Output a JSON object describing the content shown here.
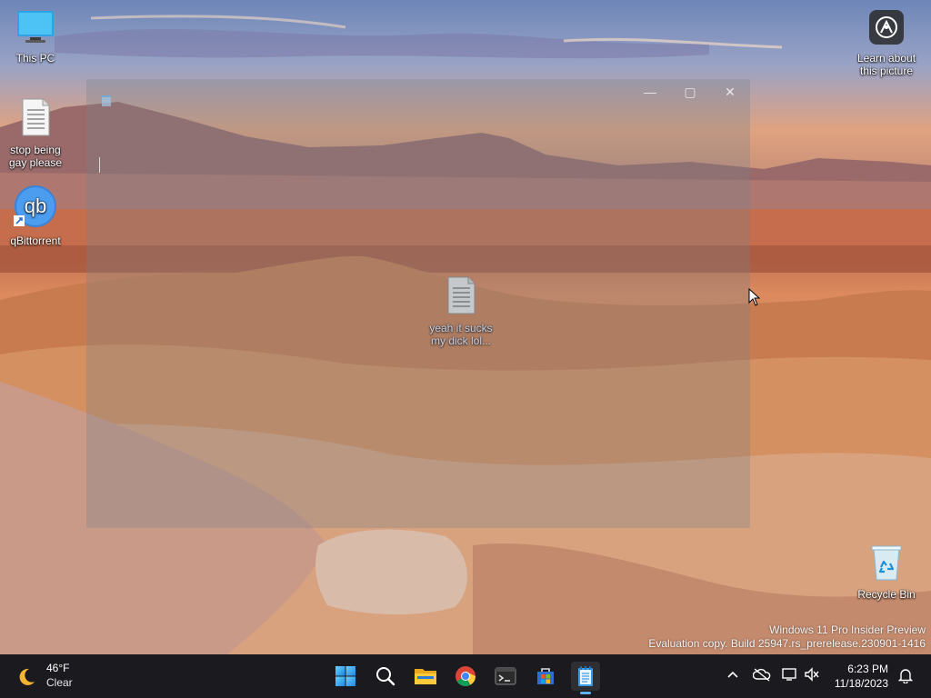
{
  "desktop": {
    "icons": [
      {
        "label": "This PC",
        "icon": "monitor-icon"
      },
      {
        "label": "stop being gay please",
        "icon": "text-file-icon"
      },
      {
        "label": "qBittorrent",
        "icon": "qbittorrent-icon"
      },
      {
        "label": "yeah it sucks my dick lol...",
        "icon": "text-file-icon"
      },
      {
        "label": "Learn about this picture",
        "icon": "camera-info-icon"
      },
      {
        "label": "Recycle Bin",
        "icon": "recycle-bin-icon"
      }
    ],
    "watermark": {
      "line1": "Windows 11 Pro Insider Preview",
      "line2": "Evaluation copy. Build 25947.rs_prerelease.230901-1416"
    }
  },
  "window": {
    "app": "Notepad",
    "minimize_glyph": "—",
    "maximize_glyph": "▢",
    "close_glyph": "✕"
  },
  "taskbar": {
    "weather": {
      "temp": "46°F",
      "condition": "Clear",
      "icon": "moon-icon"
    },
    "apps": [
      {
        "name": "Start",
        "icon": "windows-logo-icon"
      },
      {
        "name": "Search",
        "icon": "search-icon"
      },
      {
        "name": "File Explorer",
        "icon": "folder-icon"
      },
      {
        "name": "Google Chrome",
        "icon": "chrome-icon"
      },
      {
        "name": "Terminal",
        "icon": "terminal-icon"
      },
      {
        "name": "Microsoft Store",
        "icon": "store-icon"
      },
      {
        "name": "Notepad",
        "icon": "notepad-icon"
      }
    ],
    "tray": {
      "chevron": "^",
      "time": "6:23 PM",
      "date": "11/18/2023"
    }
  },
  "colors": {
    "taskbar_bg": "#1b1b1f",
    "accent": "#5fb2f2"
  }
}
